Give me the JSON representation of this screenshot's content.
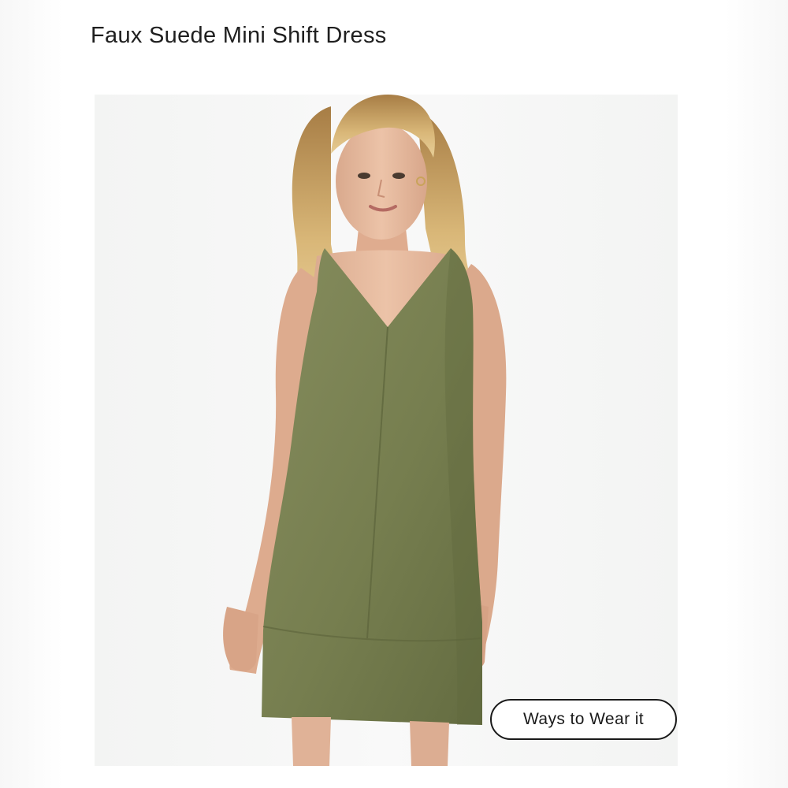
{
  "product": {
    "title": "Faux Suede Mini Shift Dress"
  },
  "image": {
    "subject": "model-wearing-olive-faux-suede-dress",
    "dress_color": "#7a8253",
    "background_color": "#f6f7f6"
  },
  "actions": {
    "ways_to_wear_label": "Ways to Wear it"
  }
}
